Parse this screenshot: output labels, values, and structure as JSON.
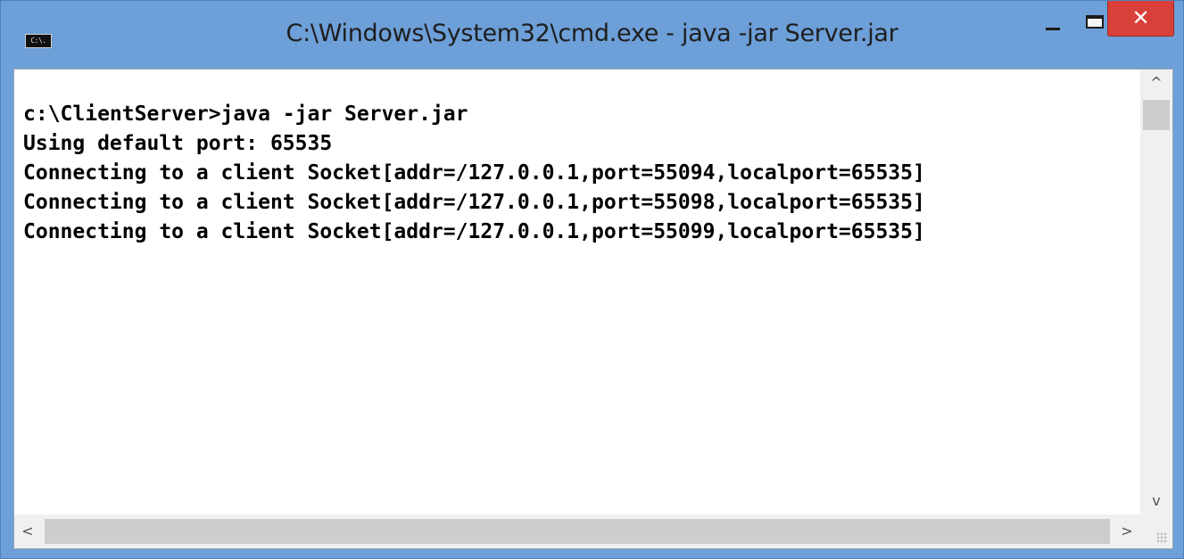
{
  "window": {
    "title": "C:\\Windows\\System32\\cmd.exe - java  -jar Server.jar",
    "icon": "cmd-icon",
    "icon_text": "C:\\.",
    "minimize_icon": "minimize-icon",
    "maximize_icon": "maximize-icon",
    "close_glyph": "✕",
    "accent_color": "#6d9fd8",
    "close_color": "#d9403a"
  },
  "console": {
    "lines": [
      "c:\\ClientServer>java -jar Server.jar",
      "Using default port: 65535",
      "Connecting to a client Socket[addr=/127.0.0.1,port=55094,localport=65535]",
      "Connecting to a client Socket[addr=/127.0.0.1,port=55098,localport=65535]",
      "Connecting to a client Socket[addr=/127.0.0.1,port=55099,localport=65535]"
    ]
  },
  "scrollbars": {
    "up_glyph": "^",
    "down_glyph": "v",
    "left_glyph": "<",
    "right_glyph": ">"
  }
}
